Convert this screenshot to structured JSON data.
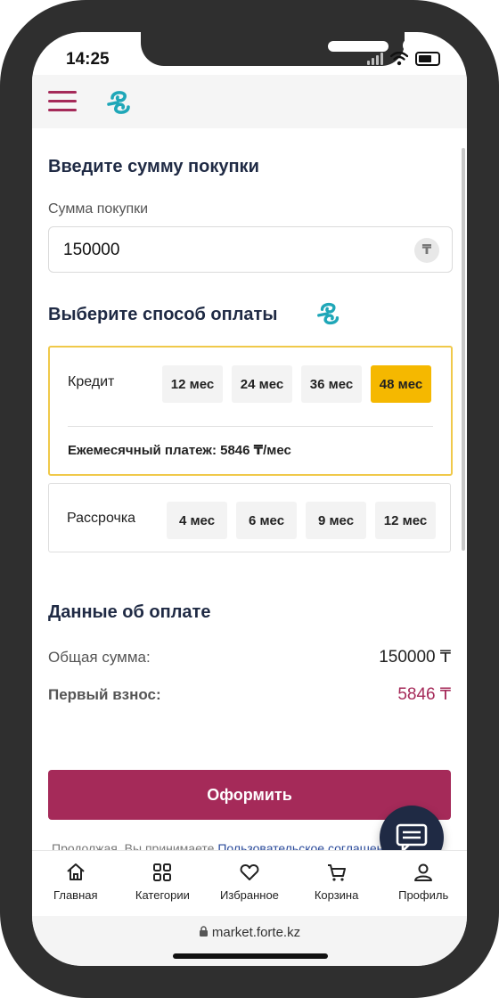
{
  "status_bar": {
    "time": "14:25"
  },
  "header": {
    "menu_icon": "hamburger-icon",
    "logo_icon": "forte-logo-icon"
  },
  "purchase": {
    "title": "Введите сумму покупки",
    "amount_label": "Сумма покупки",
    "amount_value": "150000",
    "currency_icon": "tenge-icon",
    "currency_symbol": "₸"
  },
  "payment_method": {
    "title": "Выберите способ оплаты",
    "credit": {
      "label": "Кредит",
      "options": [
        "12 мес",
        "24 мес",
        "36 мес",
        "48 мес"
      ],
      "selected": "48 мес",
      "monthly_payment": "Ежемесячный платеж: 5846 ₸/мес"
    },
    "installment": {
      "label": "Рассрочка",
      "options": [
        "4 мес",
        "6 мес",
        "9 мес",
        "12 мес"
      ]
    }
  },
  "payment_details": {
    "title": "Данные об оплате",
    "total_label": "Общая сумма:",
    "total_value": "150000 ₸",
    "first_payment_label": "Первый взнос:",
    "first_payment_value": "5846 ₸"
  },
  "checkout_button": "Оформить",
  "agreement": {
    "text": "Продолжая, Вы принимаете ",
    "link": "Пользовательское соглашение"
  },
  "chat_icon": "chat-icon",
  "bottom_nav": [
    {
      "label": "Главная",
      "icon": "home-icon"
    },
    {
      "label": "Категории",
      "icon": "categories-icon"
    },
    {
      "label": "Избранное",
      "icon": "heart-icon"
    },
    {
      "label": "Корзина",
      "icon": "cart-icon"
    },
    {
      "label": "Профиль",
      "icon": "profile-icon"
    }
  ],
  "browser": {
    "url": "market.forte.kz"
  },
  "colors": {
    "brand": "#a52a59",
    "accent_selected": "#f5b800",
    "logo": "#1fa7b8",
    "dark": "#1f2a44"
  }
}
